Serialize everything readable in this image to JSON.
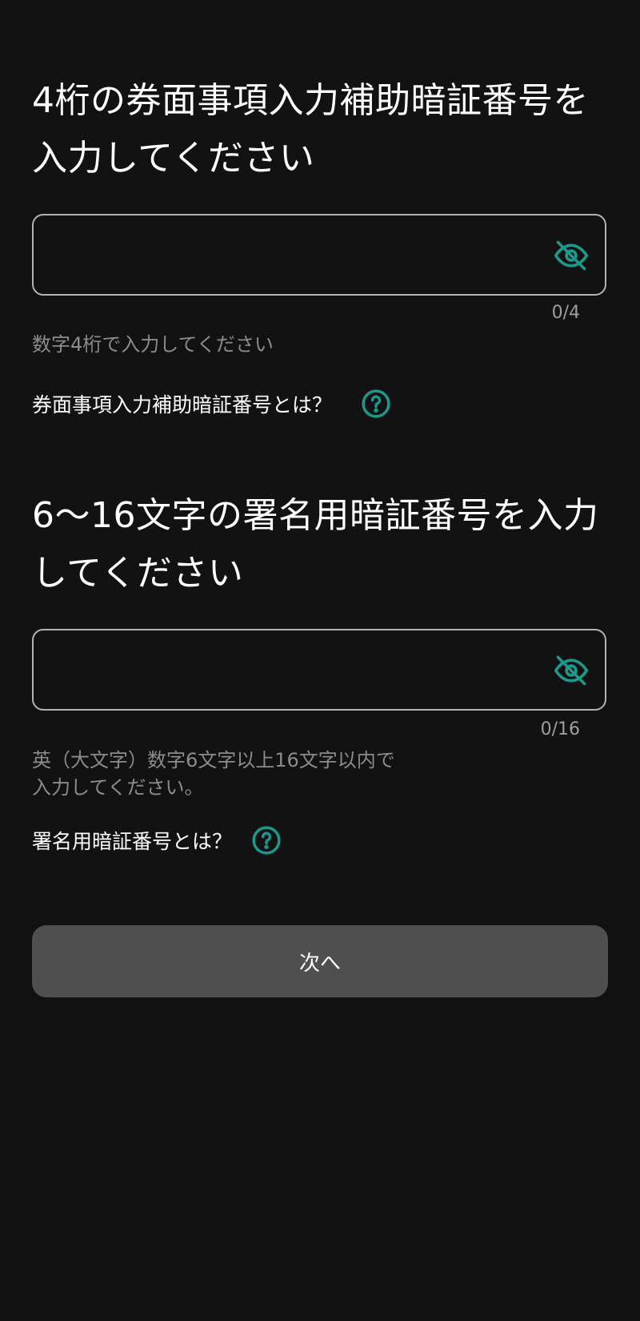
{
  "section1": {
    "title": "4桁の券面事項入力補助暗証番号を入力してください",
    "input_value": "",
    "counter": "0/4",
    "hint": "数字4桁で入力してください",
    "help_label": "券面事項入力補助暗証番号とは？",
    "eye_icon": "eye-off-icon",
    "help_icon": "question-circle-icon"
  },
  "section2": {
    "title": "6〜16文字の署名用暗証番号を入力してください",
    "input_value": "",
    "counter": "0/16",
    "hint": "英（大文字）数字6文字以上16文字以内で\n入力してください。",
    "help_label": "署名用暗証番号とは？",
    "eye_icon": "eye-off-icon",
    "help_icon": "question-circle-icon"
  },
  "next_button": {
    "label": "次へ"
  },
  "colors": {
    "background": "#121212",
    "accent": "#1a9a8c",
    "field_border": "#b3b3b3",
    "hint_text": "#8c8c8c",
    "button_bg": "#4f4f4f"
  }
}
